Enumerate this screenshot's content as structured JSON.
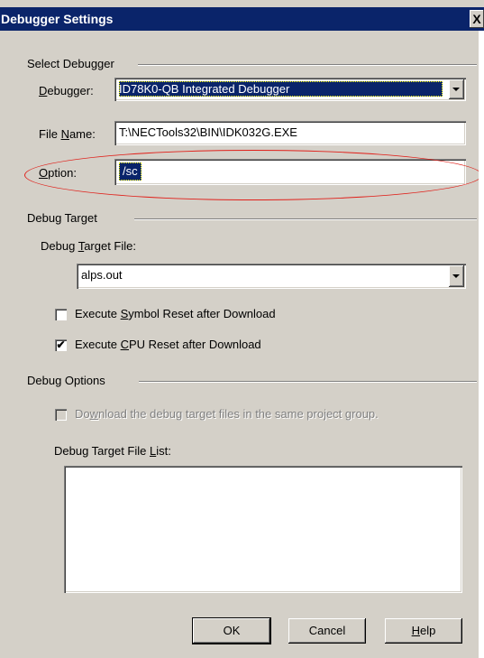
{
  "window": {
    "title": "Debugger Settings",
    "close_glyph": "X"
  },
  "select_debugger": {
    "group_label": "Select Debugger",
    "debugger_label_pre": "",
    "debugger_label_u": "D",
    "debugger_label_post": "ebugger:",
    "debugger_value": "ID78K0-QB Integrated Debugger",
    "filename_label_pre": "File ",
    "filename_label_u": "N",
    "filename_label_post": "ame:",
    "filename_value": "T:\\NECTools32\\BIN\\IDK032G.EXE",
    "option_label_pre": "",
    "option_label_u": "O",
    "option_label_post": "ption:",
    "option_value": "/sc"
  },
  "debug_target": {
    "group_label": "Debug Target",
    "file_label_pre": "Debug ",
    "file_label_u": "T",
    "file_label_post": "arget File:",
    "file_value": "alps.out",
    "symbol_reset_pre": "Execute ",
    "symbol_reset_u": "S",
    "symbol_reset_post": "ymbol Reset after Download",
    "symbol_reset_checked": false,
    "cpu_reset_pre": "Execute ",
    "cpu_reset_u": "C",
    "cpu_reset_post": "PU Reset after Download",
    "cpu_reset_checked": true,
    "check_glyph": "✔"
  },
  "debug_options": {
    "group_label": "Debug Options",
    "download_pre": "Do",
    "download_u": "w",
    "download_post": "nload the debug target files in the same project group.",
    "download_enabled": false,
    "list_label_pre": "Debug Target File ",
    "list_label_u": "L",
    "list_label_post": "ist:",
    "list_items": []
  },
  "buttons": {
    "ok": "OK",
    "cancel": "Cancel",
    "help_u": "H",
    "help_post": "elp"
  },
  "colors": {
    "title_bar": "#0a246a",
    "dialog_face": "#d4d0c8",
    "selection": "#0a246a",
    "annotation_ellipse": "#e0201a"
  }
}
